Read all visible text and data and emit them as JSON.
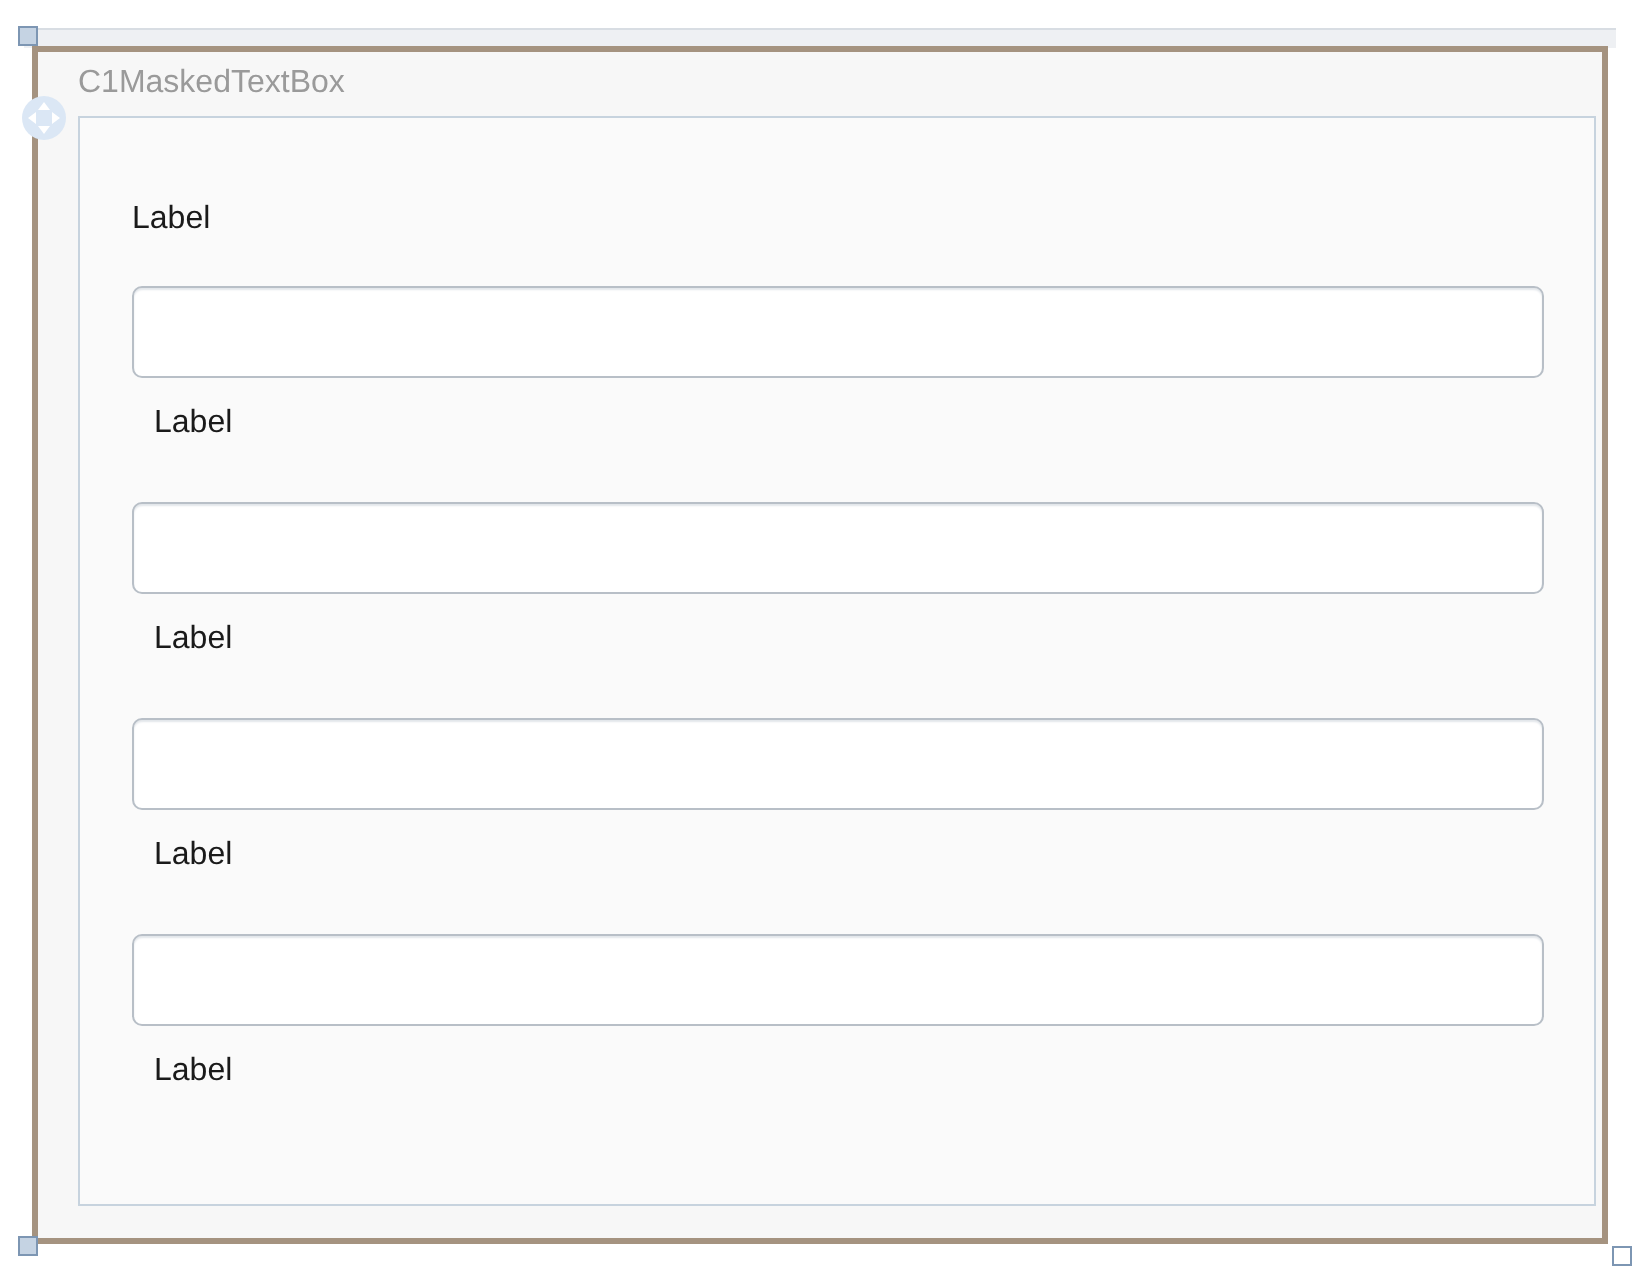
{
  "window": {
    "title": "C1MaskedTextBox"
  },
  "header_label": "Label",
  "fields": [
    {
      "label": "Label"
    },
    {
      "label": "Label"
    },
    {
      "label": "Label"
    },
    {
      "label": "Label"
    }
  ]
}
